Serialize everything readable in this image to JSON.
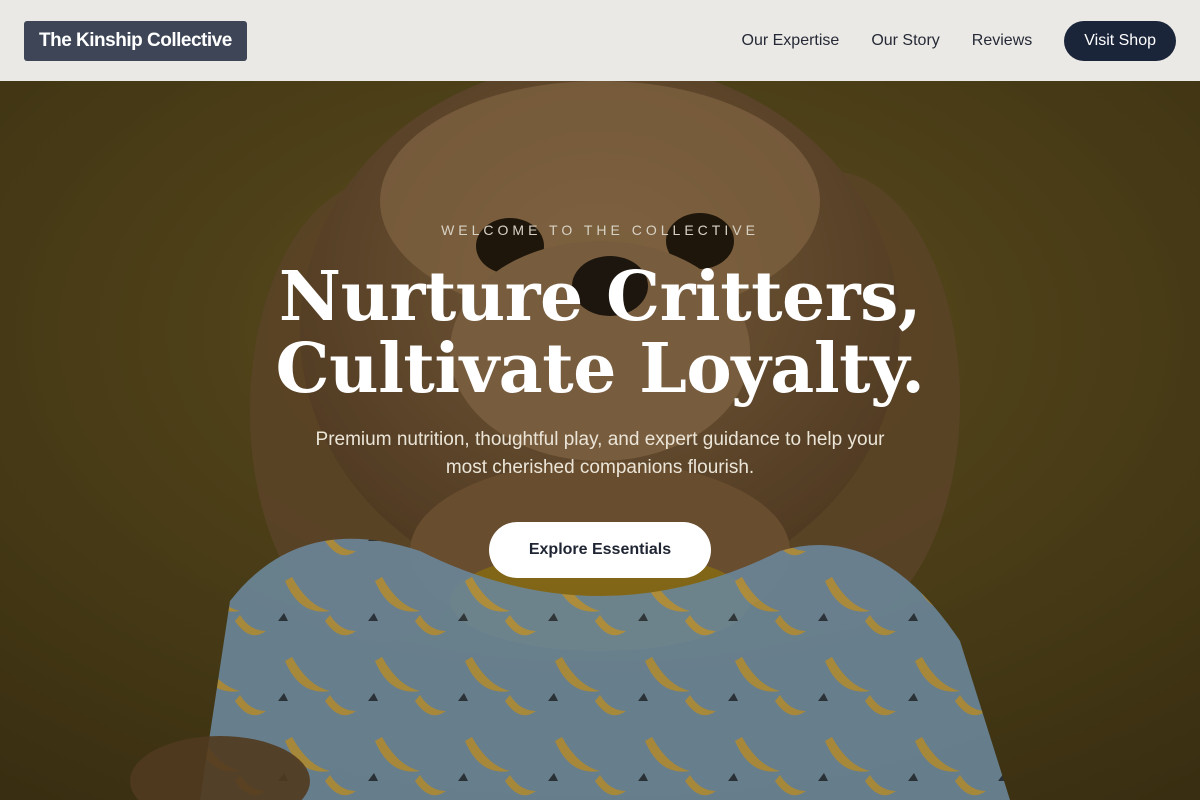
{
  "nav": {
    "brand": "The Kinship Collective",
    "links": [
      "Our Expertise",
      "Our Story",
      "Reviews"
    ],
    "cta_label": "Visit Shop"
  },
  "hero": {
    "eyebrow": "WELCOME TO THE COLLECTIVE",
    "headline_line1": "Nurture Critters,",
    "headline_line2": "Cultivate Loyalty.",
    "subtitle_line1": "Premium nutrition, thoughtful play, and expert guidance to help your",
    "subtitle_line2": "most cherished companions flourish.",
    "cta_label": "Explore Essentials",
    "image_icon": "dog-in-banana-shirt-photo"
  },
  "colors": {
    "nav_bg": "#ebe9e6",
    "brand_bg": "#3d4557",
    "primary_button": "#1b253a",
    "hero_bg": "#5a4a1c",
    "shirt": "#8fb6d6",
    "banana": "#e8c35a"
  }
}
